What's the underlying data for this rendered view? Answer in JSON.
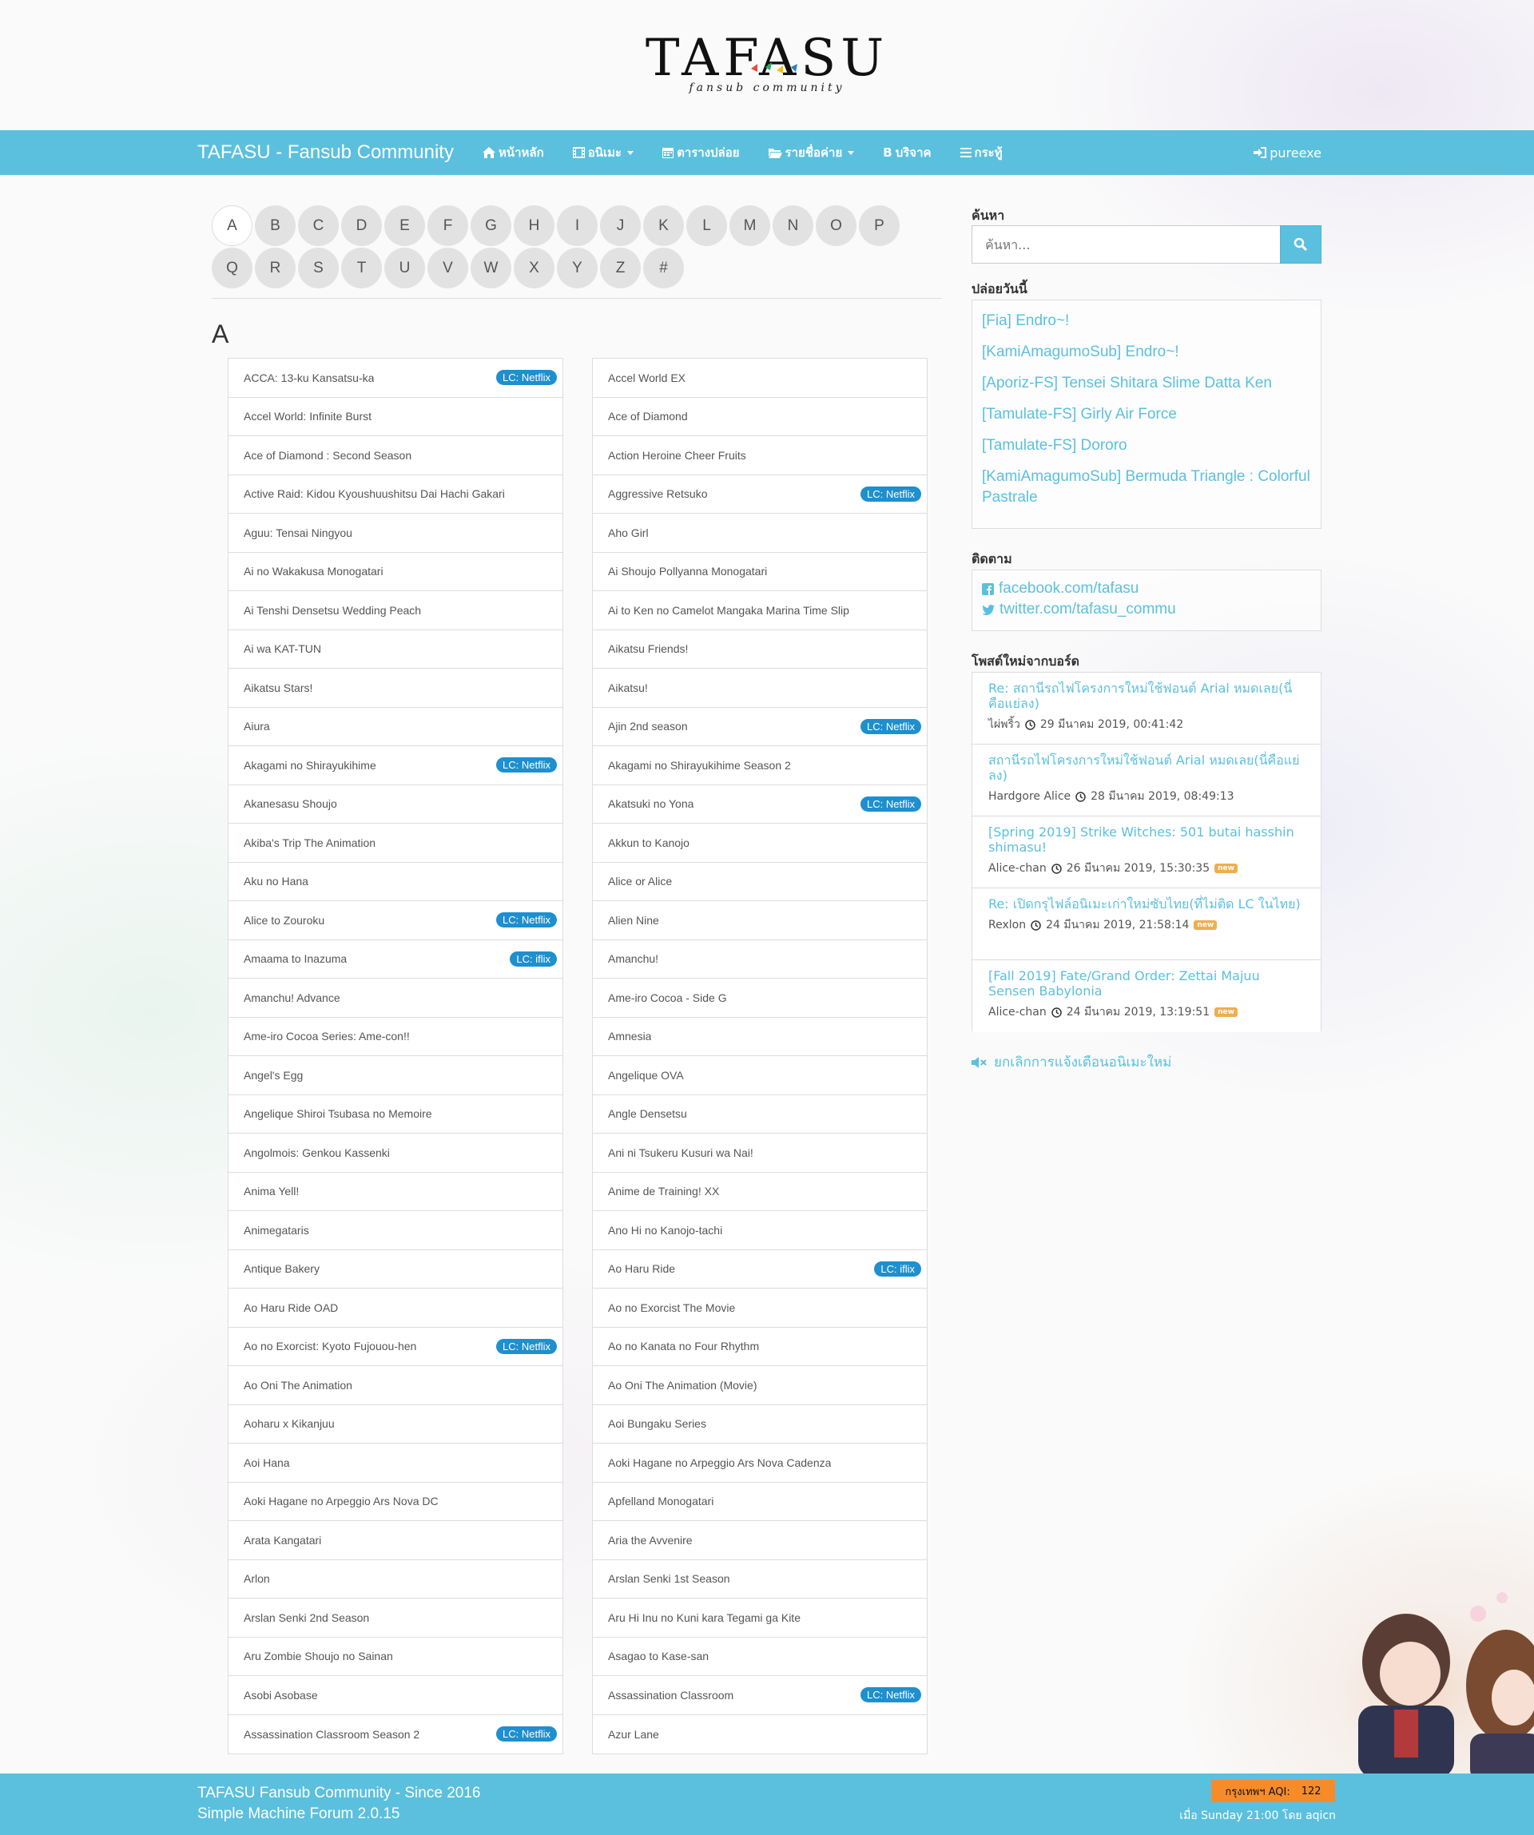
{
  "header": {
    "logo_text": "TAFASU",
    "logo_sub": "fansub community"
  },
  "nav": {
    "brand": "TAFASU - Fansub Community",
    "items": [
      {
        "icon": "home-icon",
        "label": "หน้าหลัก",
        "dropdown": false
      },
      {
        "icon": "film-icon",
        "label": "อนิเมะ",
        "dropdown": true
      },
      {
        "icon": "calendar-icon",
        "label": "ตารางปล่อย",
        "dropdown": false
      },
      {
        "icon": "folder-icon",
        "label": "รายชื่อค่าย",
        "dropdown": true
      },
      {
        "icon": "bitcoin-icon",
        "label": "บริจาค",
        "dropdown": false
      },
      {
        "icon": "list-icon",
        "label": "กระทู้",
        "dropdown": false
      }
    ],
    "user": "pureexe"
  },
  "letters": {
    "row1": [
      "A",
      "B",
      "C",
      "D",
      "E",
      "F",
      "G",
      "H",
      "I",
      "J",
      "K",
      "L",
      "M",
      "N",
      "O",
      "P"
    ],
    "row2": [
      "Q",
      "R",
      "S",
      "T",
      "U",
      "V",
      "W",
      "X",
      "Y",
      "Z",
      "#"
    ],
    "active": "A"
  },
  "section_letter": "A",
  "anime": {
    "left": [
      {
        "title": "ACCA: 13-ku Kansatsu-ka",
        "badge": "LC: Netflix"
      },
      {
        "title": "Accel World: Infinite Burst",
        "badge": ""
      },
      {
        "title": "Ace of Diamond : Second Season",
        "badge": ""
      },
      {
        "title": "Active Raid: Kidou Kyoushuushitsu Dai Hachi Gakari",
        "badge": ""
      },
      {
        "title": "Aguu: Tensai Ningyou",
        "badge": ""
      },
      {
        "title": "Ai no Wakakusa Monogatari",
        "badge": ""
      },
      {
        "title": "Ai Tenshi Densetsu Wedding Peach",
        "badge": ""
      },
      {
        "title": "Ai wa KAT-TUN",
        "badge": ""
      },
      {
        "title": "Aikatsu Stars!",
        "badge": ""
      },
      {
        "title": "Aiura",
        "badge": ""
      },
      {
        "title": "Akagami no Shirayukihime",
        "badge": "LC: Netflix"
      },
      {
        "title": "Akanesasu Shoujo",
        "badge": ""
      },
      {
        "title": "Akiba's Trip The Animation",
        "badge": ""
      },
      {
        "title": "Aku no Hana",
        "badge": ""
      },
      {
        "title": "Alice to Zouroku",
        "badge": "LC: Netflix"
      },
      {
        "title": "Amaama to Inazuma",
        "badge": "LC: iflix"
      },
      {
        "title": "Amanchu! Advance",
        "badge": ""
      },
      {
        "title": "Ame-iro Cocoa Series: Ame-con!!",
        "badge": ""
      },
      {
        "title": "Angel's Egg",
        "badge": ""
      },
      {
        "title": "Angelique Shiroi Tsubasa no Memoire",
        "badge": ""
      },
      {
        "title": "Angolmois: Genkou Kassenki",
        "badge": ""
      },
      {
        "title": "Anima Yell!",
        "badge": ""
      },
      {
        "title": "Animegataris",
        "badge": ""
      },
      {
        "title": "Antique Bakery",
        "badge": ""
      },
      {
        "title": "Ao Haru Ride OAD",
        "badge": ""
      },
      {
        "title": "Ao no Exorcist: Kyoto Fujouou-hen",
        "badge": "LC: Netflix"
      },
      {
        "title": "Ao Oni The Animation",
        "badge": ""
      },
      {
        "title": "Aoharu x Kikanjuu",
        "badge": ""
      },
      {
        "title": "Aoi Hana",
        "badge": ""
      },
      {
        "title": "Aoki Hagane no Arpeggio Ars Nova DC",
        "badge": ""
      },
      {
        "title": "Arata Kangatari",
        "badge": ""
      },
      {
        "title": "Arlon",
        "badge": ""
      },
      {
        "title": "Arslan Senki 2nd Season",
        "badge": ""
      },
      {
        "title": "Aru Zombie Shoujo no Sainan",
        "badge": ""
      },
      {
        "title": "Asobi Asobase",
        "badge": ""
      },
      {
        "title": "Assassination Classroom Season 2",
        "badge": "LC: Netflix"
      }
    ],
    "right": [
      {
        "title": "Accel World EX",
        "badge": ""
      },
      {
        "title": "Ace of Diamond",
        "badge": ""
      },
      {
        "title": "Action Heroine Cheer Fruits",
        "badge": ""
      },
      {
        "title": "Aggressive Retsuko",
        "badge": "LC: Netflix"
      },
      {
        "title": "Aho Girl",
        "badge": ""
      },
      {
        "title": "Ai Shoujo Pollyanna Monogatari",
        "badge": ""
      },
      {
        "title": "Ai to Ken no Camelot Mangaka Marina Time Slip",
        "badge": ""
      },
      {
        "title": "Aikatsu Friends!",
        "badge": ""
      },
      {
        "title": "Aikatsu!",
        "badge": ""
      },
      {
        "title": "Ajin 2nd season",
        "badge": "LC: Netflix"
      },
      {
        "title": "Akagami no Shirayukihime Season 2",
        "badge": ""
      },
      {
        "title": "Akatsuki no Yona",
        "badge": "LC: Netflix"
      },
      {
        "title": "Akkun to Kanojo",
        "badge": ""
      },
      {
        "title": "Alice or Alice",
        "badge": ""
      },
      {
        "title": "Alien Nine",
        "badge": ""
      },
      {
        "title": "Amanchu!",
        "badge": ""
      },
      {
        "title": "Ame-iro Cocoa - Side G",
        "badge": ""
      },
      {
        "title": "Amnesia",
        "badge": ""
      },
      {
        "title": "Angelique OVA",
        "badge": ""
      },
      {
        "title": "Angle Densetsu",
        "badge": ""
      },
      {
        "title": "Ani ni Tsukeru Kusuri wa Nai!",
        "badge": ""
      },
      {
        "title": "Anime de Training! XX",
        "badge": ""
      },
      {
        "title": "Ano Hi no Kanojo-tachi",
        "badge": ""
      },
      {
        "title": "Ao Haru Ride",
        "badge": "LC: iflix"
      },
      {
        "title": "Ao no Exorcist The Movie",
        "badge": ""
      },
      {
        "title": "Ao no Kanata no Four Rhythm",
        "badge": ""
      },
      {
        "title": "Ao Oni The Animation (Movie)",
        "badge": ""
      },
      {
        "title": "Aoi Bungaku Series",
        "badge": ""
      },
      {
        "title": "Aoki Hagane no Arpeggio Ars Nova Cadenza",
        "badge": ""
      },
      {
        "title": "Apfelland Monogatari",
        "badge": ""
      },
      {
        "title": "Aria the Avvenire",
        "badge": ""
      },
      {
        "title": "Arslan Senki 1st Season",
        "badge": ""
      },
      {
        "title": "Aru Hi Inu no Kuni kara Tegami ga Kite",
        "badge": ""
      },
      {
        "title": "Asagao to Kase-san",
        "badge": ""
      },
      {
        "title": "Assassination Classroom",
        "badge": "LC: Netflix"
      },
      {
        "title": "Azur Lane",
        "badge": ""
      }
    ]
  },
  "sidebar": {
    "search_title": "ค้นหา",
    "search_placeholder": "ค้นหา...",
    "release_title": "ปล่อยวันนี้",
    "releases": [
      "[Fia] Endro~!",
      "[KamiAmagumoSub] Endro~!",
      "[Aporiz-FS] Tensei Shitara Slime Datta Ken",
      "[Tamulate-FS] Girly Air Force",
      "[Tamulate-FS] Dororo",
      "[KamiAmagumoSub] Bermuda Triangle : Colorful Pastrale"
    ],
    "follow_title": "ติดตาม",
    "follow": [
      {
        "icon": "facebook-icon",
        "label": "facebook.com/tafasu"
      },
      {
        "icon": "twitter-icon",
        "label": "twitter.com/tafasu_commu"
      }
    ],
    "posts_title": "โพสต์ใหม่จากบอร์ด",
    "posts": [
      {
        "title": "Re: สถานีรถไฟโครงการใหม่ใช้ฟอนต์ Arial หมดเลย(นี่คือแย่ลง)",
        "author": "ไผ่พริ้ว",
        "time": "29 มีนาคม 2019, 00:41:42",
        "new": ""
      },
      {
        "title": "สถานีรถไฟโครงการใหม่ใช้ฟอนต์ Arial หมดเลย(นี่คือแย่ลง)",
        "author": "Hardgore Alice",
        "time": "28 มีนาคม 2019, 08:49:13",
        "new": ""
      },
      {
        "title": "[Spring 2019] Strike Witches: 501 butai hasshin shimasu!",
        "author": "Alice-chan",
        "time": "26 มีนาคม 2019, 15:30:35",
        "new": "new"
      },
      {
        "title": "Re: เปิดกรุไฟล์อนิเมะเก่าใหม่ซับไทย(ที่ไม่ติด LC ในไทย)",
        "author": "Rexlon",
        "time": "24 มีนาคม 2019, 21:58:14",
        "new": "new"
      },
      {
        "title": "[Fall 2019] Fate/Grand Order: Zettai Majuu Sensen Babylonia",
        "author": "Alice-chan",
        "time": "24 มีนาคม 2019, 13:19:51",
        "new": "new"
      }
    ],
    "unsubscribe": "ยกเลิกการแจ้งเตือนอนิเมะใหม่"
  },
  "footer": {
    "line1": "TAFASU Fansub Community - Since 2016",
    "line2": "Simple Machine Forum 2.0.15",
    "aqi_label": "กรุงเทพฯ AQI:",
    "aqi_value": "122",
    "aqi_time": "เมื่อ Sunday 21:00 โดย aqicn"
  },
  "colors": {
    "accent": "#5bc0de",
    "badge": "#1e8fcf",
    "new_badge": "#f0ad4e",
    "aqi": "#f58c29"
  }
}
